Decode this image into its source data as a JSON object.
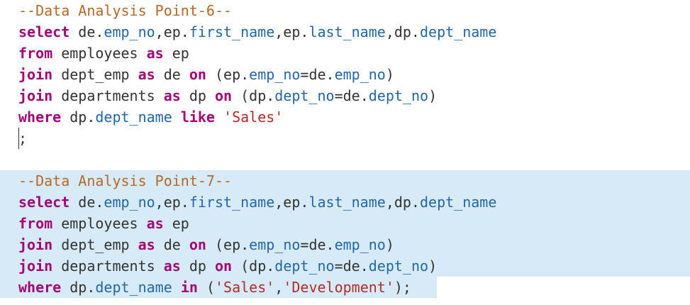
{
  "editor": {
    "colors": {
      "comment": "#b4682a",
      "keyword": "#a40075",
      "column": "#2366a8",
      "string": "#b22b2b",
      "plain": "#333333",
      "selection": "#d6ebf7"
    },
    "lines": [
      {
        "selected": false,
        "tokens": [
          {
            "t": "comment",
            "v": "--Data Analysis Point-6--"
          }
        ]
      },
      {
        "selected": false,
        "tokens": [
          {
            "t": "keyword",
            "v": "select"
          },
          {
            "t": "plain",
            "v": " de."
          },
          {
            "t": "column",
            "v": "emp_no"
          },
          {
            "t": "plain",
            "v": ",ep."
          },
          {
            "t": "column",
            "v": "first_name"
          },
          {
            "t": "plain",
            "v": ",ep."
          },
          {
            "t": "column",
            "v": "last_name"
          },
          {
            "t": "plain",
            "v": ",dp."
          },
          {
            "t": "column",
            "v": "dept_name"
          }
        ]
      },
      {
        "selected": false,
        "tokens": [
          {
            "t": "keyword",
            "v": "from"
          },
          {
            "t": "plain",
            "v": " employees "
          },
          {
            "t": "keyword",
            "v": "as"
          },
          {
            "t": "plain",
            "v": " ep"
          }
        ]
      },
      {
        "selected": false,
        "tokens": [
          {
            "t": "keyword",
            "v": "join"
          },
          {
            "t": "plain",
            "v": " dept_emp "
          },
          {
            "t": "keyword",
            "v": "as"
          },
          {
            "t": "plain",
            "v": " de "
          },
          {
            "t": "keyword",
            "v": "on"
          },
          {
            "t": "plain",
            "v": " (ep."
          },
          {
            "t": "column",
            "v": "emp_no"
          },
          {
            "t": "plain",
            "v": "=de."
          },
          {
            "t": "column",
            "v": "emp_no"
          },
          {
            "t": "plain",
            "v": ")"
          }
        ]
      },
      {
        "selected": false,
        "tokens": [
          {
            "t": "keyword",
            "v": "join"
          },
          {
            "t": "plain",
            "v": " departments "
          },
          {
            "t": "keyword",
            "v": "as"
          },
          {
            "t": "plain",
            "v": " dp "
          },
          {
            "t": "keyword",
            "v": "on"
          },
          {
            "t": "plain",
            "v": " (dp."
          },
          {
            "t": "column",
            "v": "dept_no"
          },
          {
            "t": "plain",
            "v": "=de."
          },
          {
            "t": "column",
            "v": "dept_no"
          },
          {
            "t": "plain",
            "v": ")"
          }
        ]
      },
      {
        "selected": false,
        "tokens": [
          {
            "t": "keyword",
            "v": "where"
          },
          {
            "t": "plain",
            "v": " dp."
          },
          {
            "t": "column",
            "v": "dept_name"
          },
          {
            "t": "plain",
            "v": " "
          },
          {
            "t": "keyword",
            "v": "like"
          },
          {
            "t": "plain",
            "v": " "
          },
          {
            "t": "string",
            "v": "'Sales'"
          }
        ]
      },
      {
        "selected": false,
        "tokens": [
          {
            "t": "plain",
            "v": ";"
          }
        ]
      },
      {
        "selected": false,
        "tokens": []
      },
      {
        "selected": "full",
        "tokens": [
          {
            "t": "comment",
            "v": "--Data Analysis Point-7--"
          }
        ]
      },
      {
        "selected": "full",
        "tokens": [
          {
            "t": "keyword",
            "v": "select"
          },
          {
            "t": "plain",
            "v": " de."
          },
          {
            "t": "column",
            "v": "emp_no"
          },
          {
            "t": "plain",
            "v": ",ep."
          },
          {
            "t": "column",
            "v": "first_name"
          },
          {
            "t": "plain",
            "v": ",ep."
          },
          {
            "t": "column",
            "v": "last_name"
          },
          {
            "t": "plain",
            "v": ",dp."
          },
          {
            "t": "column",
            "v": "dept_name"
          }
        ]
      },
      {
        "selected": "full",
        "tokens": [
          {
            "t": "keyword",
            "v": "from"
          },
          {
            "t": "plain",
            "v": " employees "
          },
          {
            "t": "keyword",
            "v": "as"
          },
          {
            "t": "plain",
            "v": " ep"
          }
        ]
      },
      {
        "selected": "full",
        "tokens": [
          {
            "t": "keyword",
            "v": "join"
          },
          {
            "t": "plain",
            "v": " dept_emp "
          },
          {
            "t": "keyword",
            "v": "as"
          },
          {
            "t": "plain",
            "v": " de "
          },
          {
            "t": "keyword",
            "v": "on"
          },
          {
            "t": "plain",
            "v": " (ep."
          },
          {
            "t": "column",
            "v": "emp_no"
          },
          {
            "t": "plain",
            "v": "=de."
          },
          {
            "t": "column",
            "v": "emp_no"
          },
          {
            "t": "plain",
            "v": ")"
          }
        ]
      },
      {
        "selected": "full",
        "tokens": [
          {
            "t": "keyword",
            "v": "join"
          },
          {
            "t": "plain",
            "v": " departments "
          },
          {
            "t": "keyword",
            "v": "as"
          },
          {
            "t": "plain",
            "v": " dp "
          },
          {
            "t": "keyword",
            "v": "on"
          },
          {
            "t": "plain",
            "v": " (dp."
          },
          {
            "t": "column",
            "v": "dept_no"
          },
          {
            "t": "plain",
            "v": "=de."
          },
          {
            "t": "column",
            "v": "dept_no"
          },
          {
            "t": "plain",
            "v": ")"
          }
        ]
      },
      {
        "selected": "partial",
        "tokens": [
          {
            "t": "keyword",
            "v": "where"
          },
          {
            "t": "plain",
            "v": " dp."
          },
          {
            "t": "column",
            "v": "dept_name"
          },
          {
            "t": "plain",
            "v": " "
          },
          {
            "t": "keyword",
            "v": "in"
          },
          {
            "t": "plain",
            "v": " ("
          },
          {
            "t": "string",
            "v": "'Sales'"
          },
          {
            "t": "plain",
            "v": ","
          },
          {
            "t": "string",
            "v": "'Development'"
          },
          {
            "t": "plain",
            "v": ");"
          }
        ]
      }
    ]
  }
}
